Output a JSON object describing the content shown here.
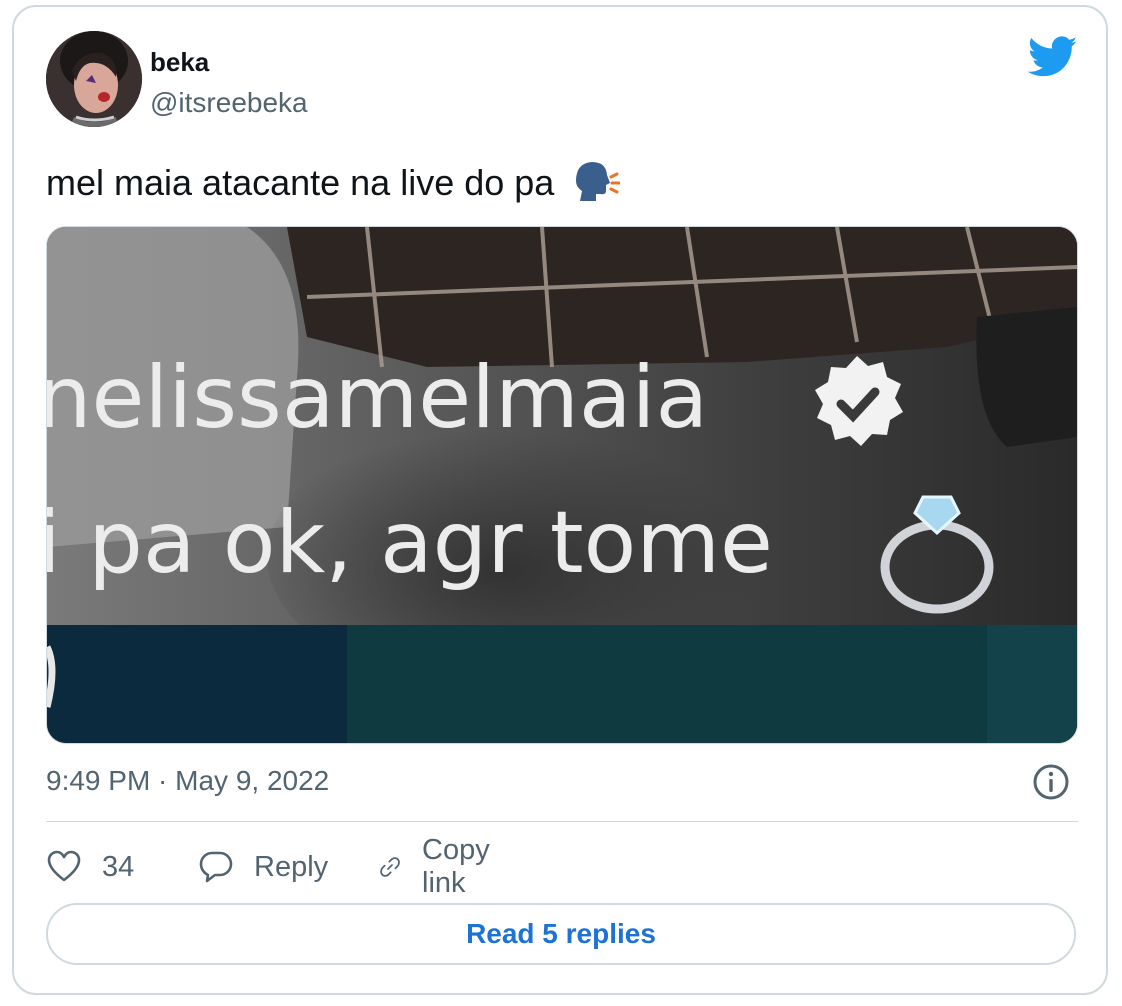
{
  "author": {
    "name": "beka",
    "handle": "@itsreebeka"
  },
  "tweet": {
    "text": "mel maia atacante na live do pa",
    "emoji": "speaking-head-emoji"
  },
  "media": {
    "caption_username": "nelissamelmaia",
    "caption_text": "i pa ok, agr tome"
  },
  "meta": {
    "timestamp": "9:49 PM · May 9, 2022"
  },
  "actions": {
    "likes": "34",
    "reply_label": "Reply",
    "copy_link_label": "Copy link"
  },
  "read_replies": "Read 5 replies",
  "colors": {
    "twitter_blue": "#1d9bf0",
    "link_blue": "#1d72d6",
    "muted": "#536471",
    "border": "#cfd9de"
  }
}
